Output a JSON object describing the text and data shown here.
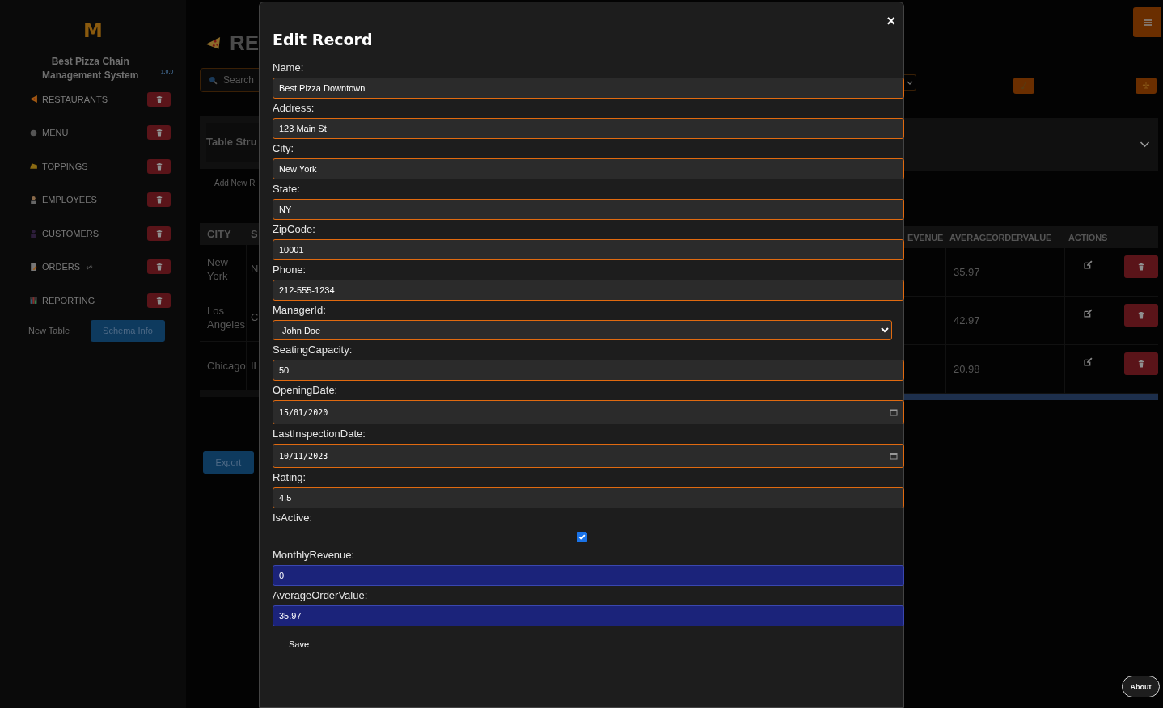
{
  "sidebar": {
    "logo": "M",
    "title": "Best Pizza Chain Management System",
    "version": "1.0.0",
    "items": [
      {
        "label": "RESTAURANTS",
        "kind": "pizza",
        "linked": false
      },
      {
        "label": "MENU",
        "kind": "plate",
        "linked": false
      },
      {
        "label": "TOPPINGS",
        "kind": "cheese",
        "linked": false
      },
      {
        "label": "EMPLOYEES",
        "kind": "cook",
        "linked": false
      },
      {
        "label": "CUSTOMERS",
        "kind": "person",
        "linked": false
      },
      {
        "label": "ORDERS",
        "kind": "memo",
        "linked": true
      },
      {
        "label": "REPORTING",
        "kind": "chart",
        "linked": false
      }
    ],
    "new_table": "New Table",
    "schema_button": "Schema Info"
  },
  "main": {
    "title": "RE",
    "search": {
      "placeholder": "Search"
    },
    "structure_panel": {
      "title": "Table Stru"
    },
    "add_record": "Add New R",
    "table": {
      "left_columns": [
        "CITY",
        "S"
      ],
      "right_columns": [
        "EVENUE",
        "AVERAGEORDERVALUE",
        "ACTIONS"
      ],
      "rows": [
        {
          "city": "New York",
          "state": "N",
          "average": "35.97"
        },
        {
          "city": "Los Angeles",
          "state": "C",
          "average": "42.97"
        },
        {
          "city": "Chicago",
          "state": "IL",
          "average": "20.98"
        }
      ]
    },
    "export_button": "Export"
  },
  "modal": {
    "title": "Edit Record",
    "close": "×",
    "fields": [
      {
        "label": "Name:",
        "kind": "text",
        "value": "Best Pizza Downtown"
      },
      {
        "label": "Address:",
        "kind": "text",
        "value": "123 Main St"
      },
      {
        "label": "City:",
        "kind": "text",
        "value": "New York"
      },
      {
        "label": "State:",
        "kind": "text",
        "value": "NY"
      },
      {
        "label": "ZipCode:",
        "kind": "text",
        "value": "10001"
      },
      {
        "label": "Phone:",
        "kind": "text",
        "value": "212-555-1234"
      },
      {
        "label": "ManagerId:",
        "kind": "select",
        "value": "John Doe"
      },
      {
        "label": "SeatingCapacity:",
        "kind": "text",
        "value": "50"
      },
      {
        "label": "OpeningDate:",
        "kind": "date",
        "value": "15/01/2020"
      },
      {
        "label": "LastInspectionDate:",
        "kind": "date",
        "value": "10/11/2023"
      },
      {
        "label": "Rating:",
        "kind": "text",
        "value": "4,5"
      },
      {
        "label": "IsActive:",
        "kind": "checkbox",
        "checked": true
      },
      {
        "label": "MonthlyRevenue:",
        "kind": "computed",
        "value": "0"
      },
      {
        "label": "AverageOrderValue:",
        "kind": "computed",
        "value": "35.97"
      }
    ],
    "save_button": "Save"
  },
  "about_button": "About"
}
